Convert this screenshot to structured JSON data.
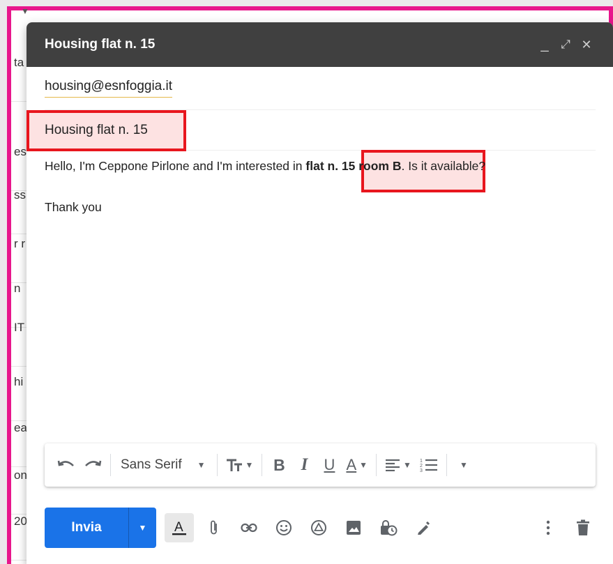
{
  "window": {
    "title": "Housing flat n. 15",
    "minimize_label": "_",
    "expand_label": "⤢",
    "close_label": "✕"
  },
  "background_list": {
    "row_fragments": [
      "ta",
      "es",
      "ss",
      "r r",
      "n",
      "IT",
      "hi",
      "ea",
      "on",
      "20"
    ]
  },
  "compose": {
    "to": "housing@esnfoggia.it",
    "subject": "Housing flat n. 15",
    "body": {
      "line1_before": "Hello, I'm Ceppone Pirlone and I'm interested in ",
      "line1_bold": "flat n. 15 room B",
      "line1_after": ". Is it available?",
      "line2": "Thank you"
    }
  },
  "formatting_toolbar": {
    "undo": "undo-icon",
    "redo": "redo-icon",
    "font_family": "Sans Serif",
    "font_size": "format-size-icon",
    "bold": "B",
    "italic": "I",
    "underline": "U",
    "text_color": "A",
    "align": "align-icon",
    "numbered_list": "numbered-list-icon",
    "more": "more-formatting-icon"
  },
  "actions": {
    "send_label": "Invia",
    "send_options": "chevron-down-icon",
    "icons": [
      "text-format-icon",
      "attach-icon",
      "link-icon",
      "emoji-icon",
      "drive-icon",
      "photo-icon",
      "confidential-icon",
      "signature-icon"
    ],
    "more_options": "more-vert-icon",
    "discard": "trash-icon"
  },
  "colors": {
    "header_bg": "#404040",
    "send_blue": "#1a73e8",
    "highlight_red": "#e8161e",
    "frame_pink": "#e8168c"
  }
}
